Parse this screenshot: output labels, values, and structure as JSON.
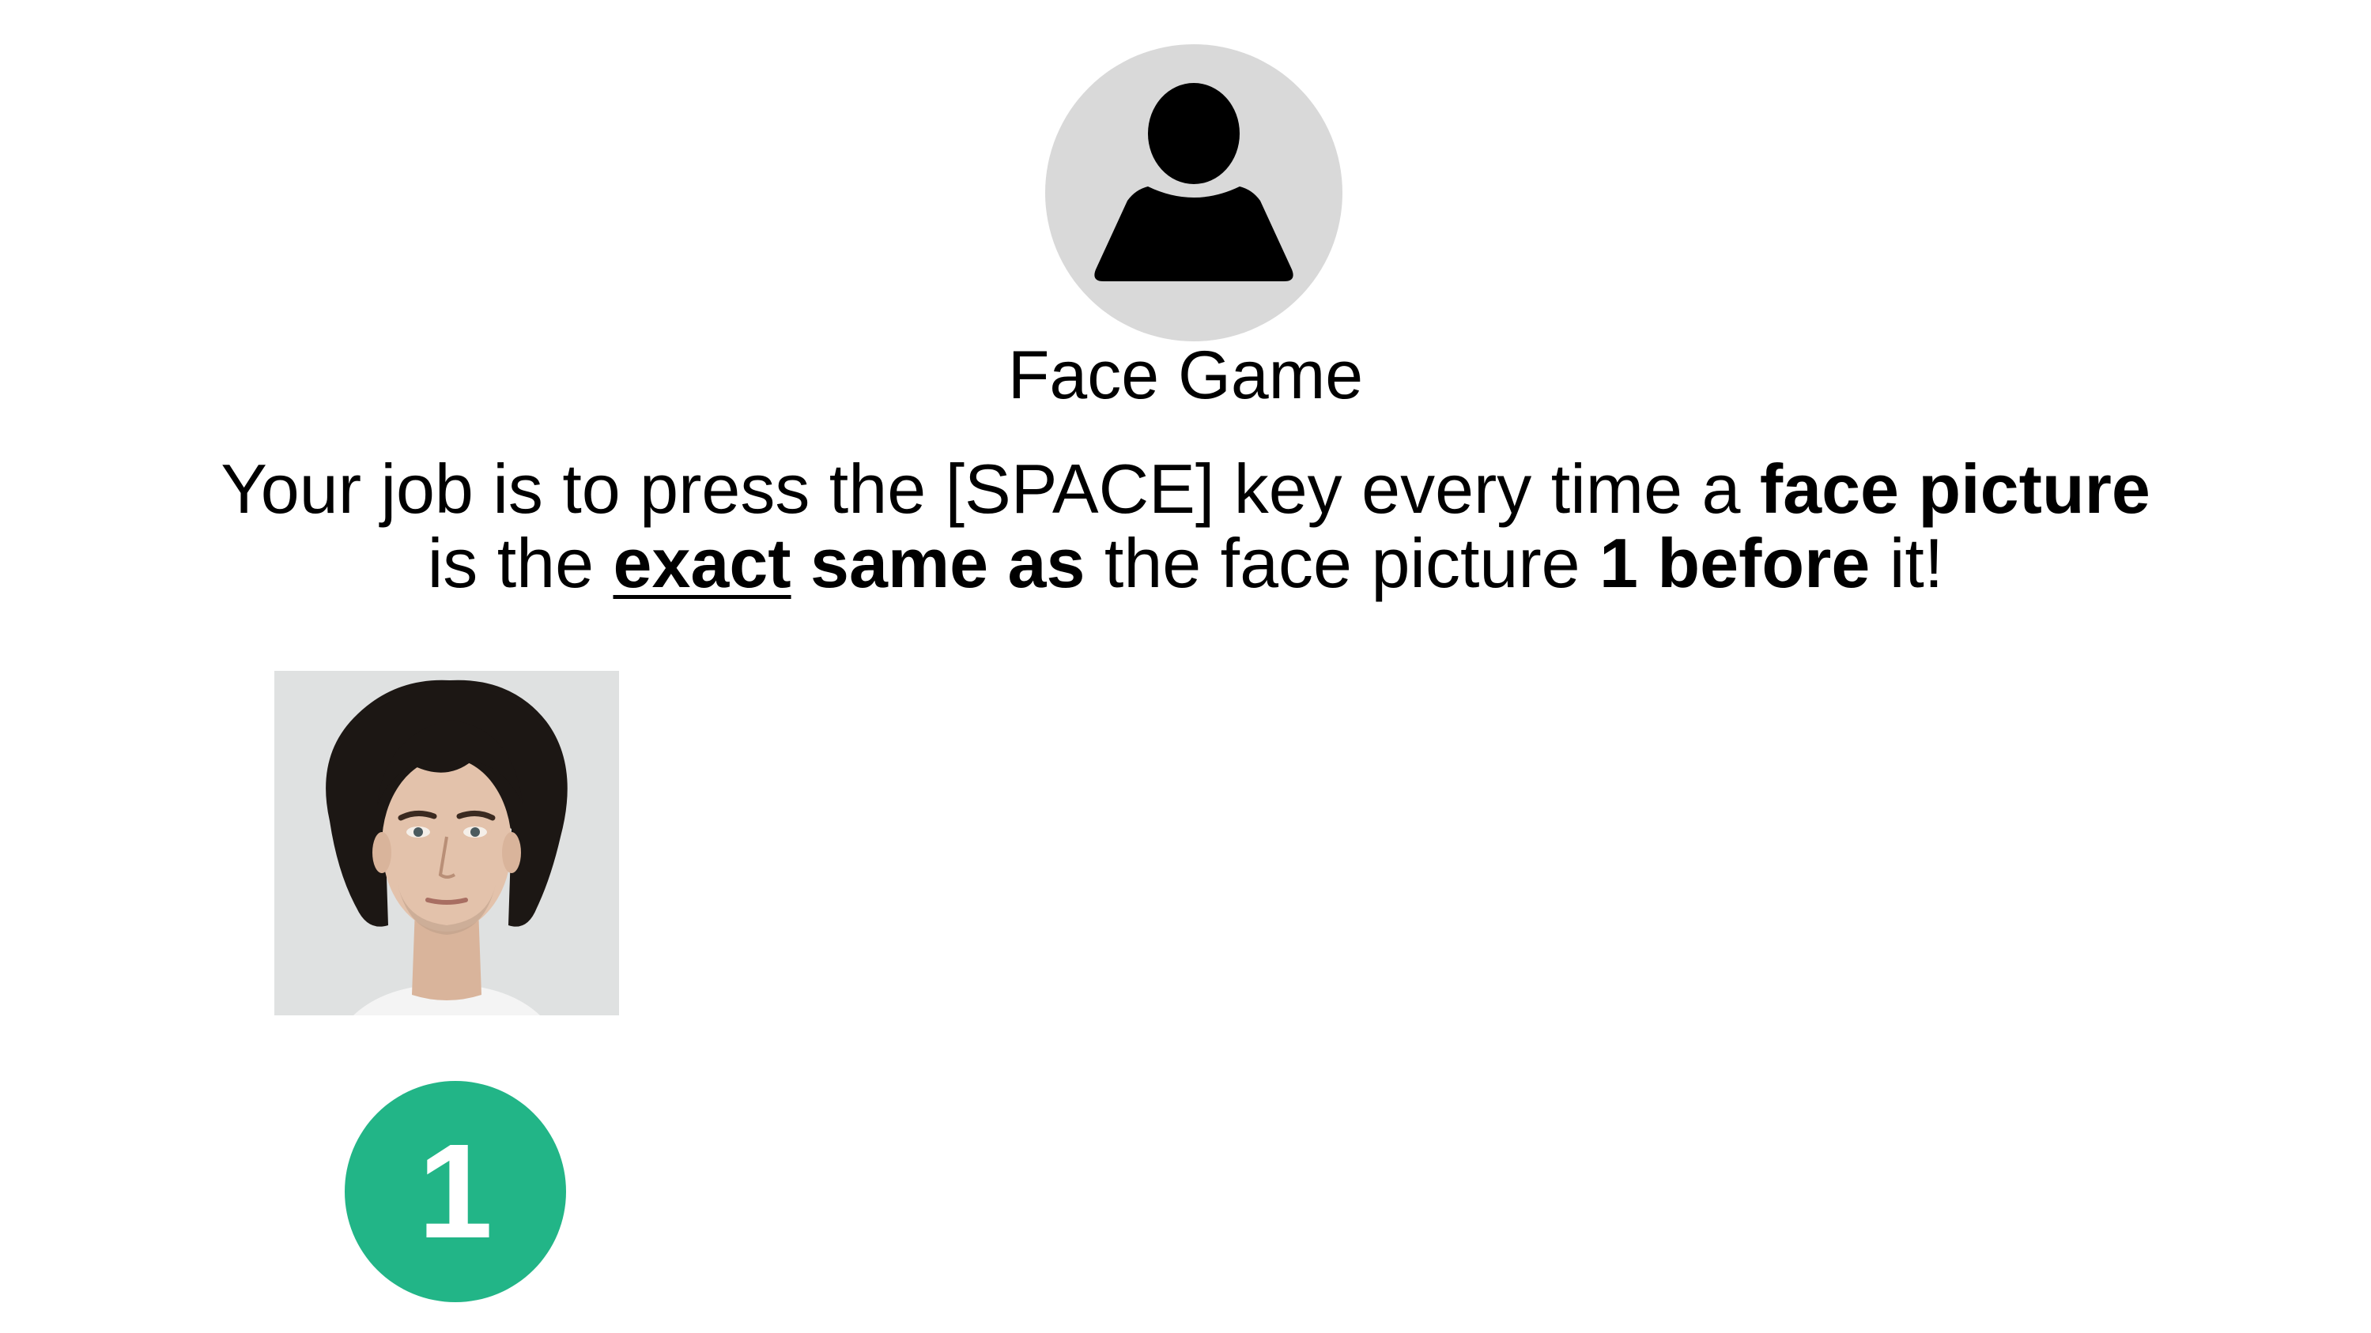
{
  "header": {
    "avatar_icon": "user-silhouette-icon",
    "title": "Face Game"
  },
  "instructions": {
    "line1_prefix": "Your job is to press the [SPACE] key every time a ",
    "line1_bold": "face picture",
    "line2_prefix": "is the ",
    "line2_exact": "exact",
    "line2_space": " ",
    "line2_same_as": "same as",
    "line2_middle": " the face picture ",
    "line2_one_before": "1 before",
    "line2_suffix": " it!"
  },
  "face_sequence": {
    "items": [
      {
        "image": "face-photo",
        "position_label": "1"
      }
    ]
  },
  "colors": {
    "avatar_background": "#d9d9d9",
    "badge": "#22b587",
    "text": "#000000"
  }
}
